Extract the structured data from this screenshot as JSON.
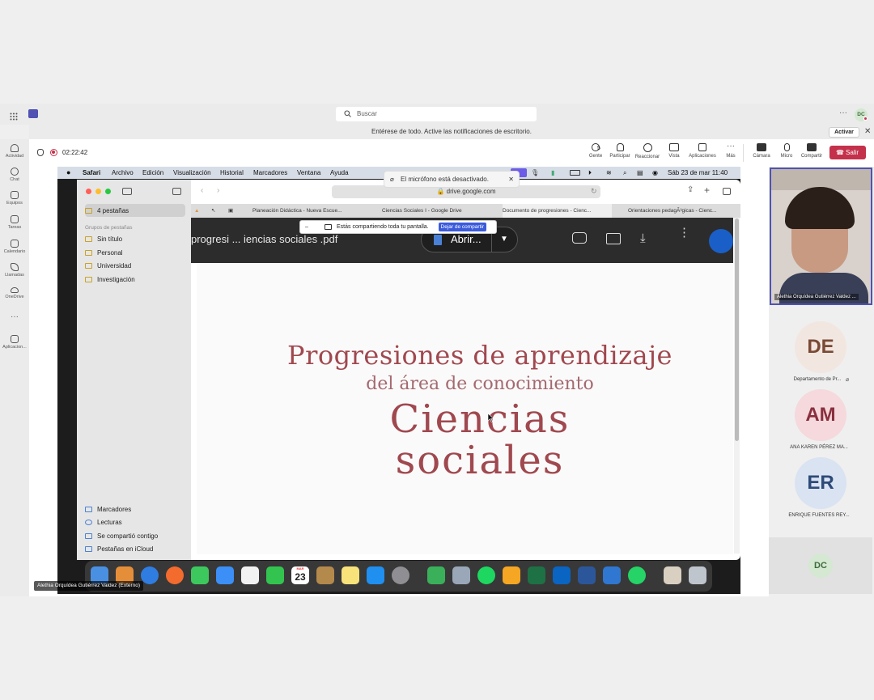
{
  "teams": {
    "search_placeholder": "Buscar",
    "notification": "Entérese de todo. Active las notificaciones de escritorio.",
    "activate_label": "Activar",
    "user_initials": "DC",
    "rail": [
      {
        "label": "Actividad",
        "icon": "bell-icon"
      },
      {
        "label": "Chat",
        "icon": "chat-icon"
      },
      {
        "label": "Equipos",
        "icon": "teams-icon"
      },
      {
        "label": "Tareas",
        "icon": "tasks-icon"
      },
      {
        "label": "Calendario",
        "icon": "calendar-icon"
      },
      {
        "label": "Llamadas",
        "icon": "phone-icon"
      },
      {
        "label": "OneDrive",
        "icon": "cloud-icon"
      },
      {
        "label": "Aplicacion...",
        "icon": "apps-icon"
      }
    ]
  },
  "meeting": {
    "timer": "02:22:42",
    "people_count": "5",
    "tools": [
      "Gente",
      "Participar",
      "Reaccionar",
      "Vista",
      "Aplicaciones",
      "Más",
      "Cámara",
      "Micro",
      "Compartir"
    ],
    "leave_label": "Salir"
  },
  "mac": {
    "menu": [
      "Safari",
      "Archivo",
      "Edición",
      "Visualización",
      "Historial",
      "Marcadores",
      "Ventana",
      "Ayuda"
    ],
    "clock": "Sáb 23 de mar  11:40",
    "mic_toast": "El micrófono está desactivado.",
    "url": "drive.google.com",
    "tab_count_label": "4 pestañas",
    "groups_header": "Grupos de pestañas",
    "groups": [
      "Sin título",
      "Personal",
      "Universidad",
      "Investigación"
    ],
    "sidebar_bottom": [
      "Marcadores",
      "Lecturas",
      "Se compartió contigo",
      "Pestañas en iCloud"
    ],
    "tabs": [
      "Planeación Didáctica - Nueva Escue...",
      "Ciencias Sociales I - Google Drive",
      "Documento de progresiones - Cienc...",
      "Orientaciones pedagÃ³gicas - Cienc..."
    ],
    "share_banner": "Estás compartiendo toda tu pantalla.",
    "stop_share": "Dejar de compartir",
    "pdf_title": "progresi ... iencias sociales .pdf",
    "open_with": "Abrir...",
    "pdf": {
      "line1": "Progresiones de aprendizaje",
      "line2": "del área de conocimiento",
      "line3": "Ciencias",
      "line4": "sociales"
    },
    "dock_date": "23",
    "dock_month": "MAR"
  },
  "presenter_label": "Alethia Orquídea Gutiérrez Valdez (Externo)",
  "participants": {
    "video_name": "Alethia Orquídea Gutiérrez Valdez ...",
    "list": [
      {
        "initials": "DE",
        "name": "Departamento de Pr...",
        "color": "#f2e6e0",
        "text": "#7a4a35"
      },
      {
        "initials": "AM",
        "name": "ANA KAREN PÉREZ MA...",
        "color": "#f5d9dc",
        "text": "#8a2f3e"
      },
      {
        "initials": "ER",
        "name": "ENRIQUE FUENTES REY...",
        "color": "#dae3f2",
        "text": "#2e4a78"
      }
    ],
    "self_initials": "DC"
  }
}
